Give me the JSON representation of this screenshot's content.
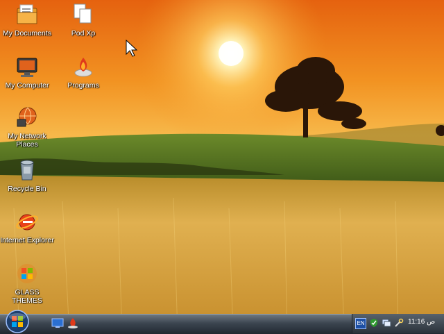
{
  "desktop": {
    "icons": [
      {
        "label": "My Documents",
        "icon": "folder-documents-icon"
      },
      {
        "label": "Pod Xp",
        "icon": "documents-stack-icon"
      },
      {
        "label": "My Computer",
        "icon": "computer-icon"
      },
      {
        "label": "Programs",
        "icon": "programs-icon"
      },
      {
        "label": "My Network Places",
        "icon": "network-icon"
      },
      {
        "label": "Recycle Bin",
        "icon": "recycle-bin-icon"
      },
      {
        "label": "Internet Explorer",
        "icon": "internet-explorer-icon"
      },
      {
        "label": "GLASS THEMES",
        "icon": "windows-logo-icon"
      }
    ]
  },
  "taskbar": {
    "start_icon": "windows-orb-icon",
    "quick_launch": [
      "show-desktop-icon",
      "programs-icon"
    ],
    "tray": {
      "language": "EN",
      "icons": [
        "shield-check-icon",
        "network-status-icon",
        "tools-icon"
      ],
      "clock": "11:16 ص"
    }
  },
  "colors": {
    "sky": "#f08a1a",
    "field": "#d7a23a",
    "taskbar": "#3c4550"
  }
}
